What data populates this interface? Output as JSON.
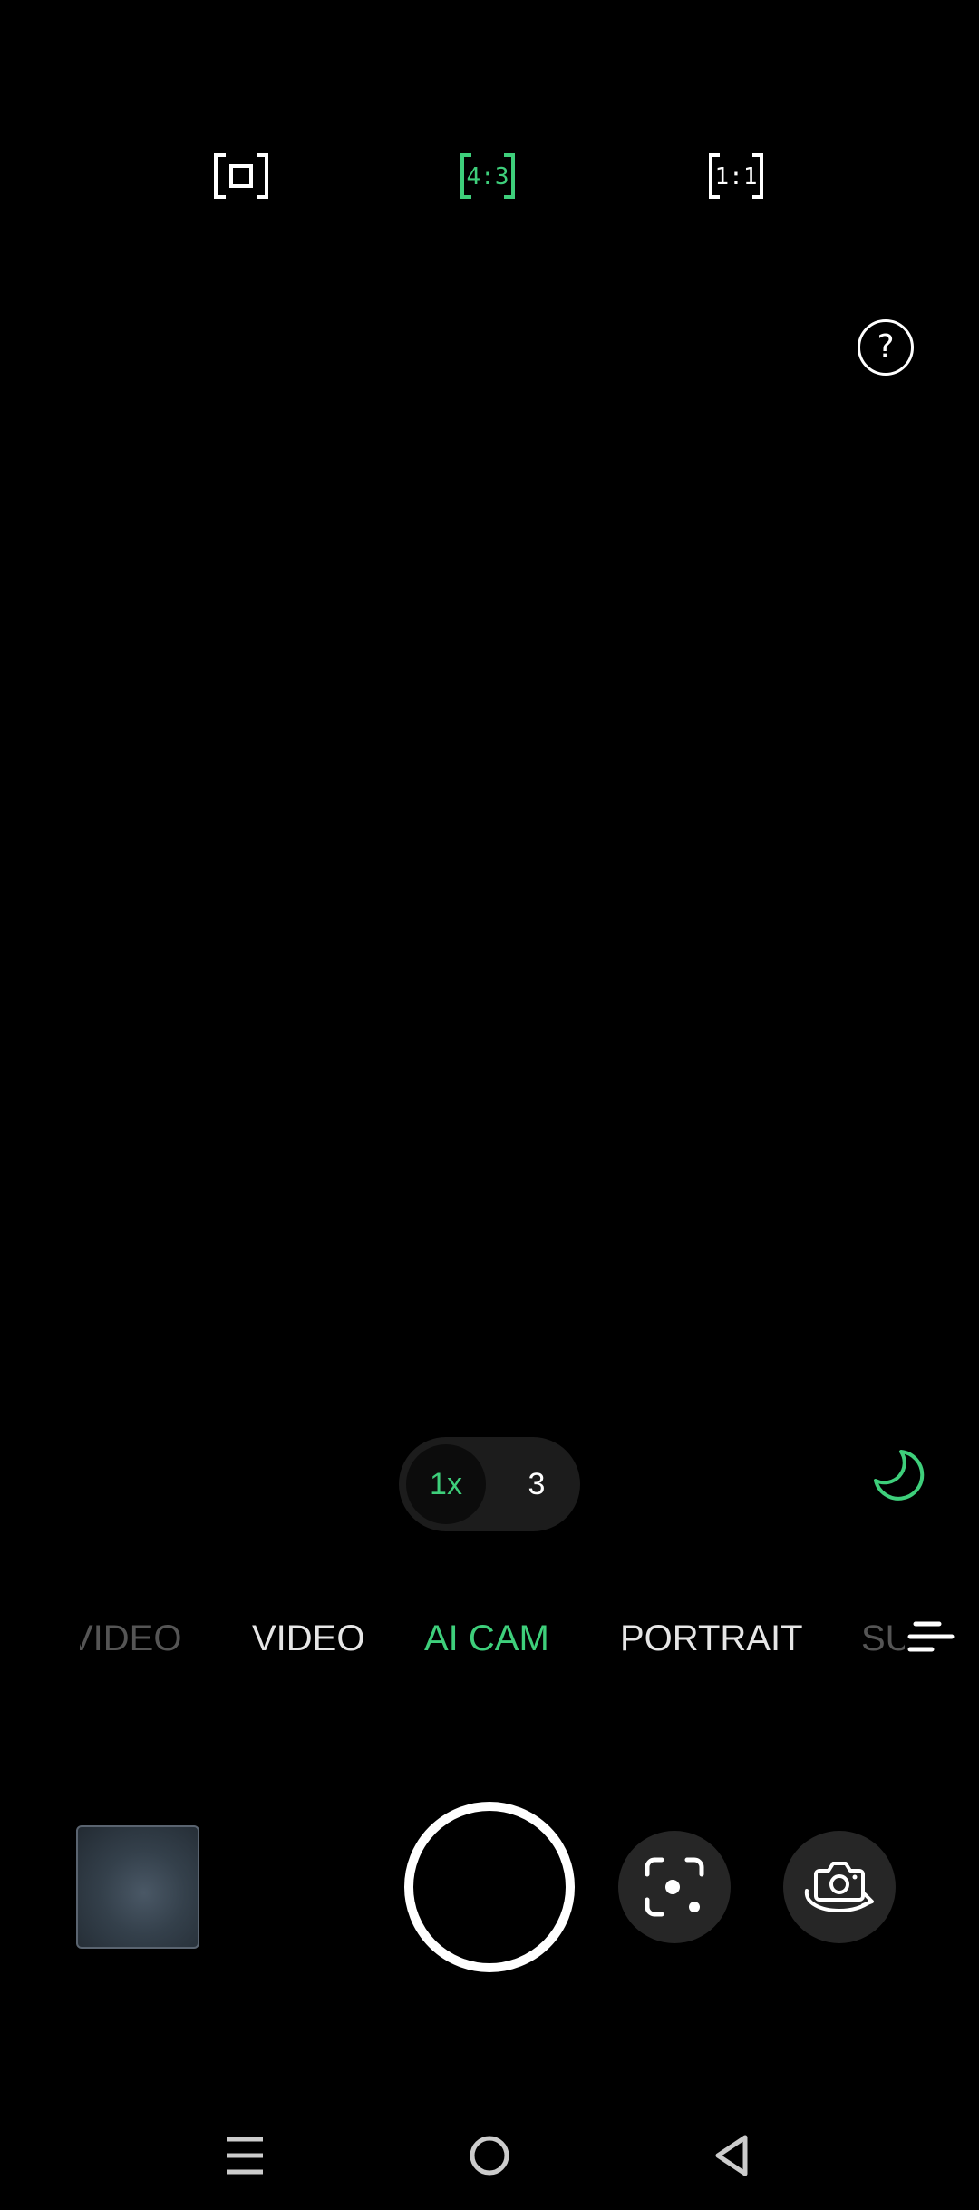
{
  "aspect_ratios": {
    "options": [
      {
        "id": "full",
        "label": "",
        "icon": "full-frame-icon",
        "active": false
      },
      {
        "id": "4:3",
        "label": "4:3",
        "icon": "ratio-4-3-icon",
        "active": true
      },
      {
        "id": "1:1",
        "label": "1:1",
        "icon": "ratio-1-1-icon",
        "active": false
      }
    ]
  },
  "help": {
    "label": "?",
    "icon": "help-icon"
  },
  "zoom": {
    "active_label": "1x",
    "other_label": "3"
  },
  "night_mode": {
    "icon": "moon-icon",
    "active": true
  },
  "modes": {
    "items": [
      "VIDEO",
      "VIDEO",
      "AI CAM",
      "PORTRAIT",
      "SU"
    ],
    "active_index": 2
  },
  "more_menu_icon": "more-modes-icon",
  "bottom": {
    "gallery_icon": "gallery-thumbnail",
    "shutter_icon": "shutter-button",
    "lens_icon": "google-lens-icon",
    "flip_icon": "flip-camera-icon"
  },
  "nav": {
    "recents_icon": "recents-icon",
    "home_icon": "home-icon",
    "back_icon": "back-icon"
  },
  "colors": {
    "accent": "#3ecf7b",
    "background": "#000000",
    "button_bg": "#262626"
  }
}
